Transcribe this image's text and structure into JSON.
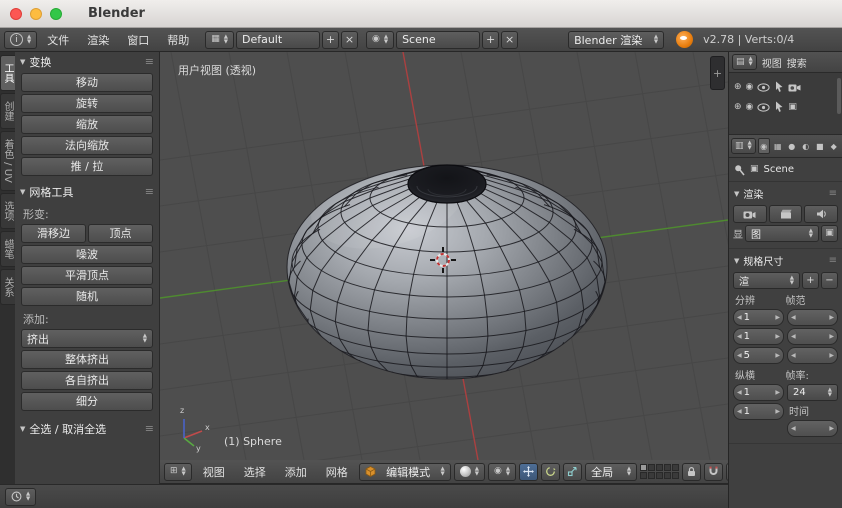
{
  "titlebar": {
    "title": "Blender"
  },
  "infobar": {
    "menus": [
      "文件",
      "渲染",
      "窗口",
      "帮助"
    ],
    "layout_value": "Default",
    "scene_value": "Scene",
    "engine_value": "Blender 渲染",
    "stats": "v2.78 | Verts:0/4"
  },
  "toolshelf": {
    "tabs": [
      "工具",
      "创建",
      "着色 / UV",
      "选项",
      "蜡笔",
      "关系"
    ],
    "transform": {
      "title": "变换",
      "buttons": [
        "移动",
        "旋转",
        "缩放",
        "法向缩放",
        "推 / 拉"
      ]
    },
    "mesh_tools": {
      "title": "网格工具",
      "deform_label": "形变:",
      "deform_split": [
        "滑移边",
        "顶点"
      ],
      "deform_buttons": [
        "噪波",
        "平滑顶点",
        "随机"
      ],
      "add_label": "添加:",
      "extrude": "挤出",
      "add_buttons": [
        "整体挤出",
        "各自挤出",
        "细分"
      ]
    },
    "select_all": {
      "title": "全选 / 取消全选"
    }
  },
  "viewport": {
    "view_label": "用户视图 (透视)",
    "object_info": "(1) Sphere",
    "axis_x": "x",
    "axis_y": "y",
    "axis_z": "z"
  },
  "view_header": {
    "menus": [
      "视图",
      "选择",
      "添加",
      "网格"
    ],
    "mode": "编辑模式",
    "orientation": "全局"
  },
  "outliner": {
    "menus": [
      "视图",
      "搜索"
    ]
  },
  "properties": {
    "context": "Scene",
    "render": {
      "title": "渲染",
      "display_label": "显",
      "display_value": "图"
    },
    "dimensions": {
      "title": "规格尺寸",
      "preset": "渲",
      "resolution_label": "分辨",
      "frame_label": "帧范",
      "res_fields": [
        "1",
        "1",
        "5"
      ],
      "aspect_label": "纵横",
      "aspect_fields": [
        "1",
        "1"
      ],
      "fps_label": "帧率:",
      "fps": "24",
      "time_label": "时间"
    }
  }
}
